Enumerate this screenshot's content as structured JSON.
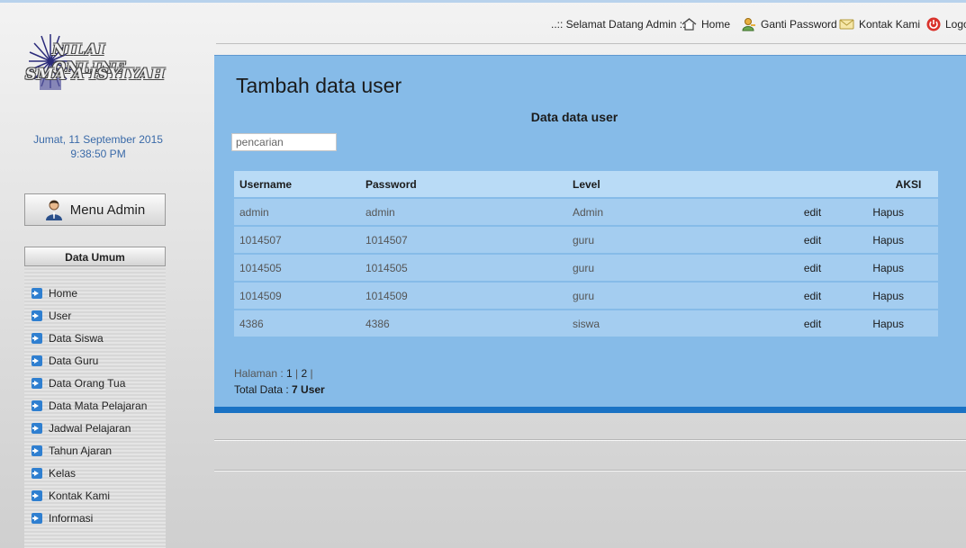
{
  "topnav": {
    "welcome": "..:: Selamat Datang Admin ::..",
    "home": "Home",
    "ganti_password": "Ganti Password",
    "kontak_kami": "Kontak Kami",
    "logout": "Logo"
  },
  "logo": {
    "line1": "NILAI ONLINE",
    "line2": "SMA A'ISYIYAH"
  },
  "sidebar": {
    "date": "Jumat, 11 September 2015",
    "time": "9:38:50 PM",
    "menu_admin": "Menu Admin",
    "section_title": "Data Umum",
    "items": [
      "Home",
      "User",
      "Data Siswa",
      "Data Guru",
      "Data Orang Tua",
      "Data Mata Pelajaran",
      "Jadwal Pelajaran",
      "Tahun Ajaran",
      "Kelas",
      "Kontak Kami",
      "Informasi"
    ]
  },
  "main": {
    "title": "Tambah data user",
    "caption": "Data data user",
    "search_placeholder": "pencarian",
    "columns": {
      "username": "Username",
      "password": "Password",
      "level": "Level",
      "aksi": "AKSI"
    },
    "rows": [
      {
        "username": "admin",
        "password": "admin",
        "level": "Admin",
        "edit": "edit",
        "hapus": "Hapus"
      },
      {
        "username": "1014507",
        "password": "1014507",
        "level": "guru",
        "edit": "edit",
        "hapus": "Hapus"
      },
      {
        "username": "1014505",
        "password": "1014505",
        "level": "guru",
        "edit": "edit",
        "hapus": "Hapus"
      },
      {
        "username": "1014509",
        "password": "1014509",
        "level": "guru",
        "edit": "edit",
        "hapus": "Hapus"
      },
      {
        "username": "4386",
        "password": "4386",
        "level": "siswa",
        "edit": "edit",
        "hapus": "Hapus"
      }
    ],
    "pager": {
      "label": "Halaman : ",
      "page1": "1",
      "sep1": " | ",
      "page2": "2",
      "sep2": " |"
    },
    "total": {
      "label": "Total Data : ",
      "value": "7 User"
    }
  },
  "colors": {
    "panel": "#86bbe8",
    "header_row": "#b9dbf6",
    "row": "#a4cdf0",
    "accent": "#1a72c4"
  }
}
